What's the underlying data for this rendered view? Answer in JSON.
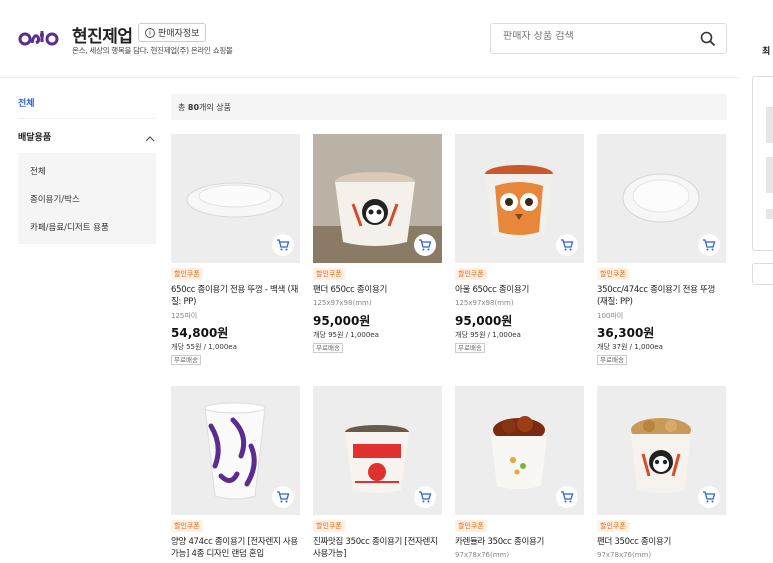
{
  "header": {
    "store_name": "현진제업",
    "seller_info_label": "판매자정보",
    "store_description": "온스, 세상의 행복을 담다. 현진제업(주) 온라인 쇼핑몰",
    "search_placeholder": "판매자 상품 검색"
  },
  "right_edge": {
    "fragment": "최"
  },
  "sidebar": {
    "all_label": "전체",
    "category_label": "배달용품",
    "sub_items": [
      "전체",
      "종이용기/박스",
      "카페/음료/디저트 용품"
    ]
  },
  "summary": {
    "prefix": "총 ",
    "count": "80",
    "suffix": "개의 상품"
  },
  "products": [
    {
      "coupon": "할인쿠폰",
      "name": "650cc 종이용기 전용 뚜껑 - 백색 (재질: PP)",
      "dimension": "125파이",
      "price": "54,800원",
      "unit_price": "개당 55원 / 1,000ea",
      "shipping": "무료배송"
    },
    {
      "coupon": "할인쿠폰",
      "name": "팬더 650cc 종이용기",
      "dimension": "125x97x98(mm)",
      "price": "95,000원",
      "unit_price": "개당 95원 / 1,000ea",
      "shipping": "무료배송"
    },
    {
      "coupon": "할인쿠폰",
      "name": "아울 650cc 종이용기",
      "dimension": "125x97x98(mm)",
      "price": "95,000원",
      "unit_price": "개당 95원 / 1,000ea",
      "shipping": "무료배송"
    },
    {
      "coupon": "할인쿠폰",
      "name": "350cc/474cc 종이용기 전용 뚜껑 (재질: PP)",
      "dimension": "100파이",
      "price": "36,300원",
      "unit_price": "개당 37원 / 1,000ea",
      "shipping": "무료배송"
    },
    {
      "coupon": "할인쿠폰",
      "name": "양양 474cc 종이용기 [전자렌지 사용가능] 4종 디자인 랜덤 혼입",
      "dimension": "",
      "price": "",
      "unit_price": "",
      "shipping": ""
    },
    {
      "coupon": "할인쿠폰",
      "name": "진짜맛집 350cc 종이용기 [전자렌지 사용가능]",
      "dimension": "",
      "price": "",
      "unit_price": "",
      "shipping": ""
    },
    {
      "coupon": "할인쿠폰",
      "name": "카렌듈라 350cc 종이용기",
      "dimension": "97x78x76(mm)",
      "price": "",
      "unit_price": "",
      "shipping": ""
    },
    {
      "coupon": "할인쿠폰",
      "name": "팬더 350cc 종이용기",
      "dimension": "97x78x76(mm)",
      "price": "",
      "unit_price": "",
      "shipping": ""
    }
  ],
  "colors": {
    "accent": "#2b62d8",
    "coupon": "#e8650a",
    "logo_purple": "#5b2d8e"
  },
  "icons": {
    "search": "search-icon",
    "cart": "cart-icon",
    "chevron": "chevron-up-icon",
    "info": "info-icon"
  }
}
